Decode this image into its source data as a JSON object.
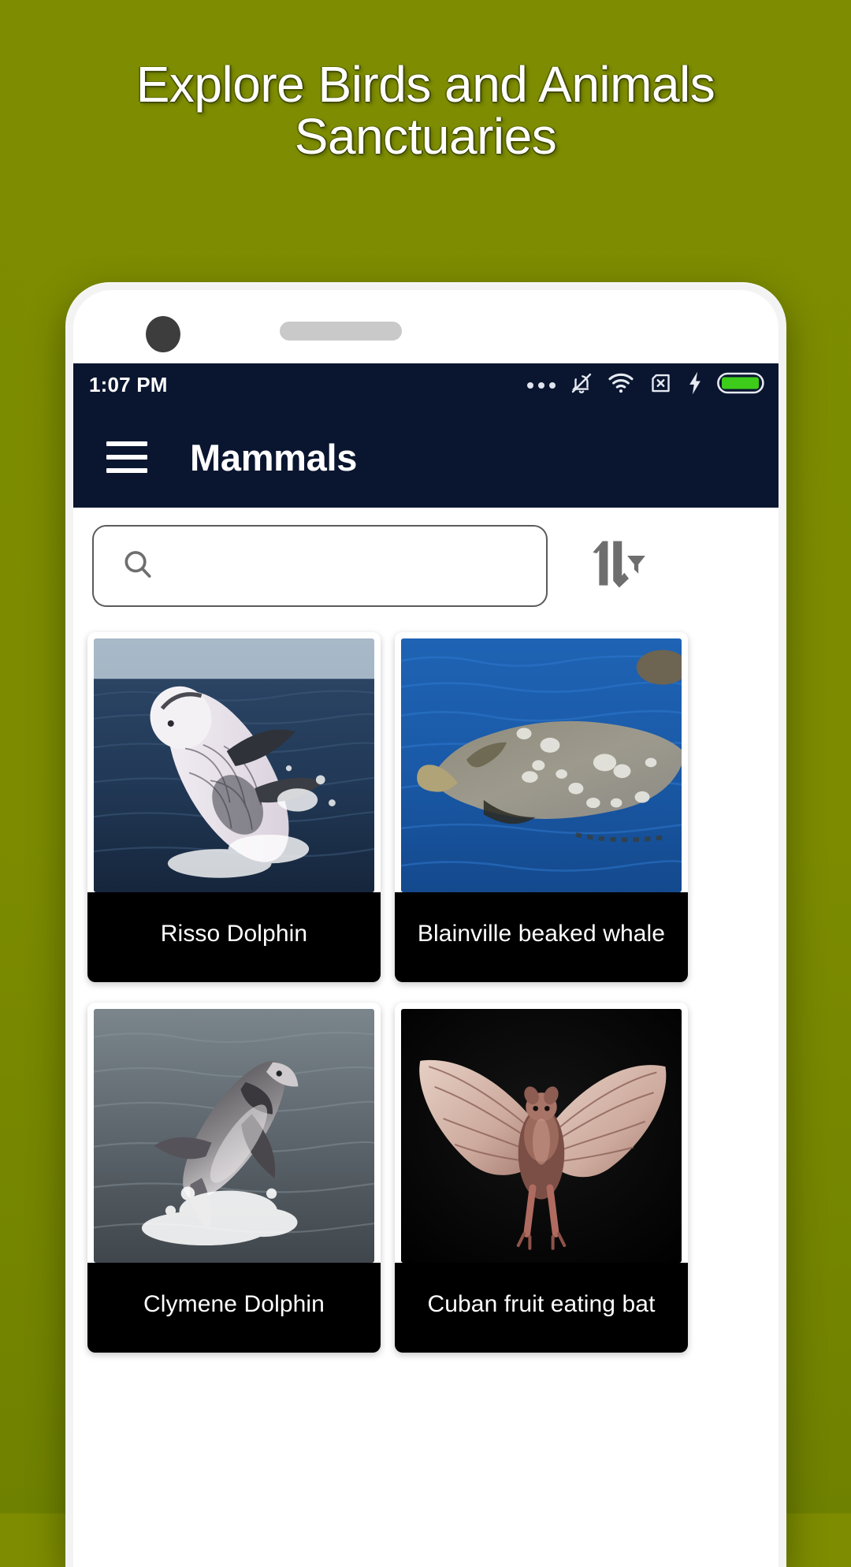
{
  "promo": {
    "line1": "Explore Birds and Animals",
    "line2": "Sanctuaries",
    "background_color": "#7d8c00",
    "text_color": "#ffffff"
  },
  "device": {
    "frame_color": "#f3f3f3",
    "camera_dot": "camera-dot",
    "speaker": "speaker-grille"
  },
  "status_bar": {
    "time": "1:07 PM",
    "background_color": "#0a1630",
    "icons": [
      {
        "name": "more-dots-icon",
        "label": "..."
      },
      {
        "name": "notifications-muted-icon",
        "label": "Notifications silenced"
      },
      {
        "name": "wifi-icon",
        "label": "Wi-Fi connected"
      },
      {
        "name": "no-sim-icon",
        "label": "No SIM"
      },
      {
        "name": "charging-bolt-icon",
        "label": "Charging"
      },
      {
        "name": "battery-icon",
        "label": "Battery full",
        "color": "#3dcc1a"
      }
    ]
  },
  "app_bar": {
    "menu_label": "Menu",
    "title": "Mammals",
    "background_color": "#0a1630"
  },
  "search": {
    "value": "",
    "placeholder": "",
    "icon": "search-icon",
    "sort_icon": "sort-filter-icon"
  },
  "grid": {
    "cards": [
      {
        "title": "Risso Dolphin",
        "image": "risso-dolphin-photo"
      },
      {
        "title": "Blainville beaked whale",
        "image": "blainville-beaked-whale-photo"
      },
      {
        "title": "Clymene Dolphin",
        "image": "clymene-dolphin-photo"
      },
      {
        "title": "Cuban fruit eating bat",
        "image": "cuban-fruit-eating-bat-photo"
      }
    ]
  }
}
